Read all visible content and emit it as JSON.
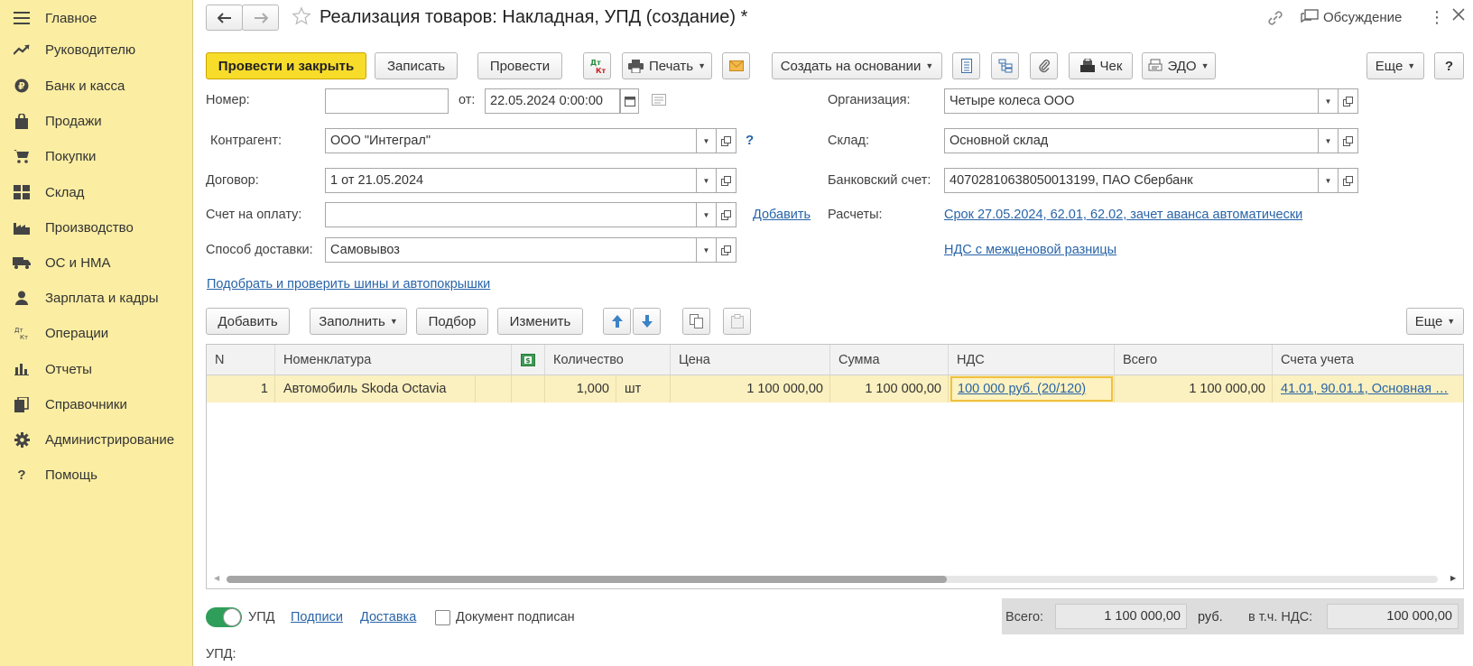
{
  "sidebar": {
    "items": [
      {
        "label": "Главное",
        "icon": "menu-icon"
      },
      {
        "label": "Руководителю",
        "icon": "trend-icon"
      },
      {
        "label": "Банк и касса",
        "icon": "coin-icon"
      },
      {
        "label": "Продажи",
        "icon": "bag-icon"
      },
      {
        "label": "Покупки",
        "icon": "cart-icon"
      },
      {
        "label": "Склад",
        "icon": "warehouse-icon"
      },
      {
        "label": "Производство",
        "icon": "factory-icon"
      },
      {
        "label": "ОС и НМА",
        "icon": "truck-icon"
      },
      {
        "label": "Зарплата и кадры",
        "icon": "person-icon"
      },
      {
        "label": "Операции",
        "icon": "dt-kt-icon"
      },
      {
        "label": "Отчеты",
        "icon": "bar-chart-icon"
      },
      {
        "label": "Справочники",
        "icon": "books-icon"
      },
      {
        "label": "Администрирование",
        "icon": "gear-icon"
      },
      {
        "label": "Помощь",
        "icon": "question-icon"
      }
    ]
  },
  "header": {
    "title": "Реализация товаров: Накладная, УПД (создание) *",
    "discussion": "Обсуждение"
  },
  "toolbar": {
    "post_close": "Провести и закрыть",
    "save": "Записать",
    "post": "Провести",
    "dt_kt_top": "Дт",
    "dt_kt_bottom": "Кт",
    "print": "Печать",
    "create_based": "Создать на основании",
    "receipt": "Чек",
    "edo": "ЭДО",
    "more": "Еще",
    "help": "?"
  },
  "form": {
    "number_label": "Номер:",
    "number_value": "",
    "from_label": "от:",
    "date_value": "22.05.2024  0:00:00",
    "org_label": "Организация:",
    "org_value": "Четыре колеса ООО",
    "counterparty_label": "Контрагент:",
    "counterparty_value": "ООО \"Интеграл\"",
    "counterparty_hint": "?",
    "warehouse_label": "Склад:",
    "warehouse_value": "Основной склад",
    "contract_label": "Договор:",
    "contract_value": "1 от 21.05.2024",
    "bank_label": "Банковский счет:",
    "bank_value": "40702810638050013199, ПАО Сбербанк",
    "invoice_label": "Счет на оплату:",
    "invoice_value": "",
    "invoice_add": "Добавить",
    "settlements_label": "Расчеты:",
    "settlements_value": "Срок 27.05.2024, 62.01, 62.02, зачет аванса автоматически",
    "delivery_label": "Способ доставки:",
    "delivery_value": "Самовывоз",
    "vat_margin": "НДС с межценовой разницы",
    "tires_link": "Подобрать и проверить шины и автопокрышки"
  },
  "table_toolbar": {
    "add": "Добавить",
    "fill": "Заполнить",
    "select": "Подбор",
    "change": "Изменить",
    "more": "Еще"
  },
  "table": {
    "columns": [
      "N",
      "Номенклатура",
      "",
      "Количество",
      "Цена",
      "Сумма",
      "НДС",
      "Всего",
      "Счета учета"
    ],
    "rows": [
      {
        "n": "1",
        "nomenclature": "Автомобиль Skoda Octavia",
        "qty": "1,000",
        "unit": "шт",
        "price": "1 100 000,00",
        "sum": "1 100 000,00",
        "vat": "100 000 руб. (20/120)",
        "total": "1 100 000,00",
        "accounts": "41.01, 90.01.1, Основная …"
      }
    ]
  },
  "footer": {
    "upd_toggle": "УПД",
    "signatures": "Подписи",
    "delivery": "Доставка",
    "signed": "Документ подписан",
    "total_label": "Всего:",
    "total_value": "1 100 000,00",
    "currency": "руб.",
    "vat_label": "в т.ч. НДС:",
    "vat_value": "100 000,00",
    "upd_label": "УПД:"
  },
  "colors": {
    "sidebar_bg": "#fbeda2",
    "primary_button": "#f8dc2a",
    "link": "#2864a8",
    "row_selected": "#fbf0bf",
    "toggle_on": "#2f9e5a"
  }
}
